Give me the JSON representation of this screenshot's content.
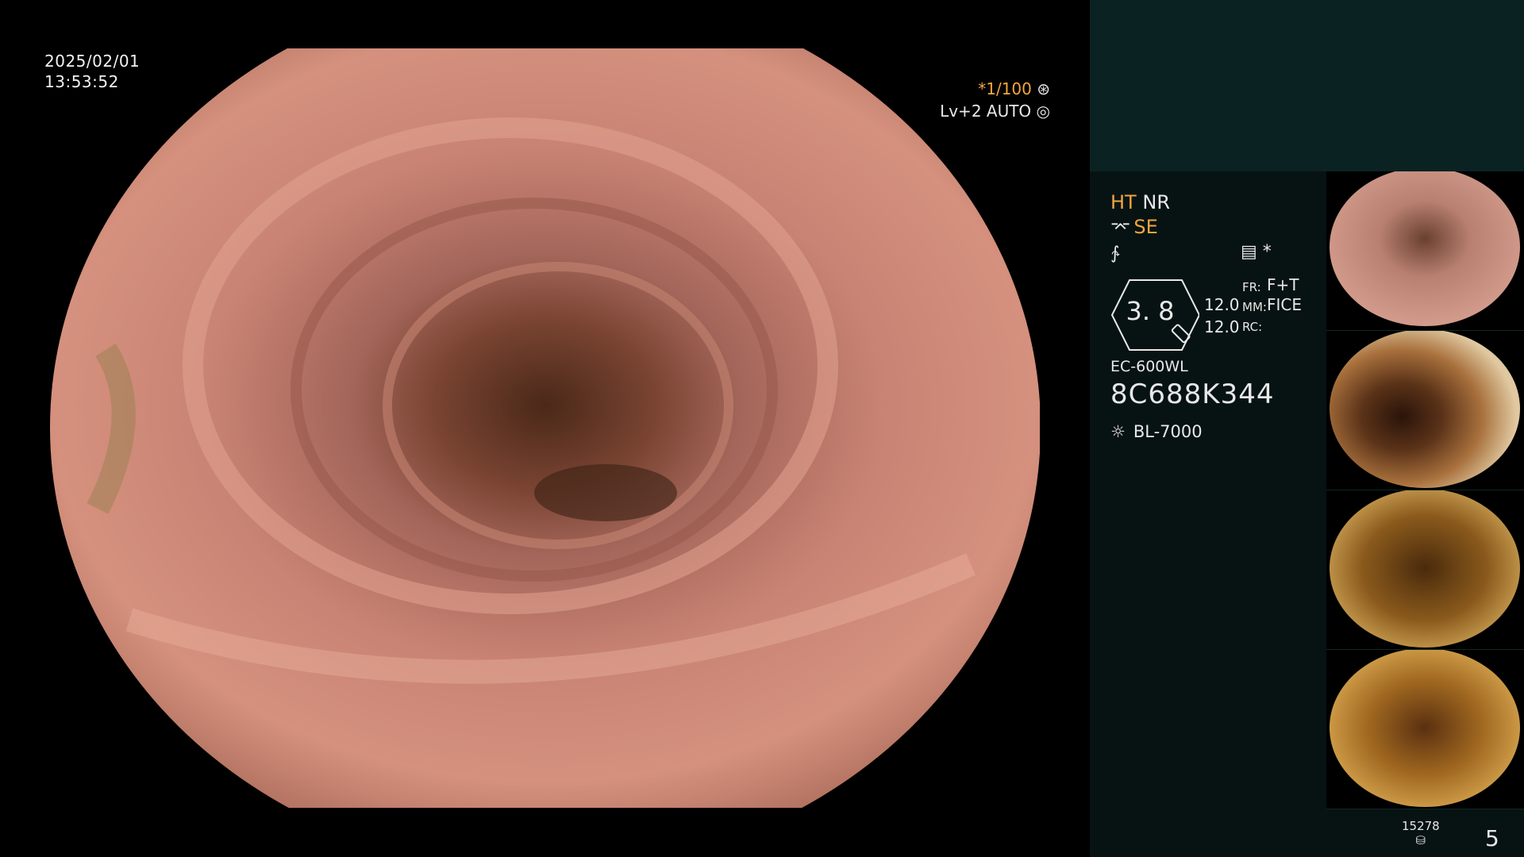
{
  "overlay": {
    "date": "2025/02/01",
    "time": "13:53:52",
    "shutter_speed": "*1/100",
    "shutter_icon": "aperture-icon",
    "iris_level": "Lv+2 AUTO",
    "iris_icon": "iris-auto-icon"
  },
  "panel": {
    "ht": "HT",
    "nr": "NR",
    "se": "SE",
    "se_icon": "structure-enhance-icon",
    "mode_icon": "contrast-mode-icon",
    "memo_icon": "memory-icon",
    "asterisk": "*",
    "zoom": "3. 8",
    "zoom_icon": "magnifier-icon",
    "value_1": "12.0",
    "value_2": "12.0",
    "fr_label": "FR:",
    "fr_value": "F+T",
    "mm_label": "MM:",
    "mm_value": "FICE",
    "rc_label": "RC:",
    "rc_value": "",
    "scope_model": "EC-600WL",
    "scope_serial": "8C688K344",
    "light_icon": "light-source-icon",
    "light_source": "BL-7000",
    "storage_count": "15278",
    "storage_icon": "storage-icon",
    "page_number": "5"
  },
  "thumbnails": [
    {
      "name": "thumbnail-1"
    },
    {
      "name": "thumbnail-2"
    },
    {
      "name": "thumbnail-3"
    },
    {
      "name": "thumbnail-4"
    }
  ],
  "colors": {
    "accent_orange": "#f2a640",
    "panel_background": "#071313",
    "panel_top_background": "#0b2223",
    "text": "#e8e8e8"
  }
}
